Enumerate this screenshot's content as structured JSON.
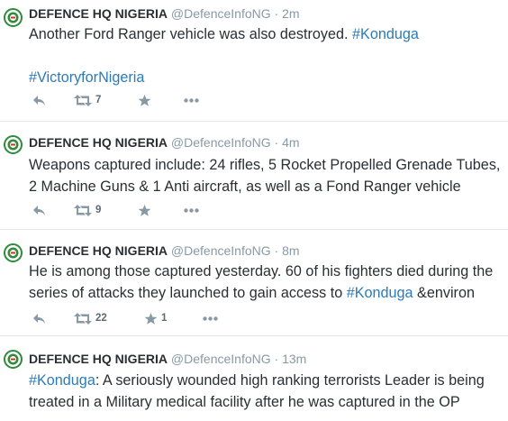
{
  "colors": {
    "link": "#2b7bb9",
    "name": "#292f33",
    "muted": "#8899a6",
    "divider": "#e1e8ed",
    "avatar_ring": "#2e8b3a"
  },
  "tweets": [
    {
      "name": "DEFENCE HQ NIGERIA",
      "handle": "@DefenceInfoNG",
      "separator": "·",
      "time": "2m",
      "text": {
        "p1": "Another Ford Ranger vehicle was also destroyed. ",
        "tag1": "#Konduga",
        "tag2": "#VictoryforNigeria"
      },
      "retweets": "7",
      "favorites": ""
    },
    {
      "name": "DEFENCE HQ NIGERIA",
      "handle": "@DefenceInfoNG",
      "separator": "·",
      "time": "4m",
      "text": {
        "line1": "Weapons captured include: 24 rifles, 5 Rocket Propelled Grenade Tubes,",
        "line2": "2 Machine Guns & 1 Anti aircraft, as well as a Fond Ranger vehicle"
      },
      "retweets": "9",
      "favorites": ""
    },
    {
      "name": "DEFENCE HQ NIGERIA",
      "handle": "@DefenceInfoNG",
      "separator": "·",
      "time": "8m",
      "text": {
        "line1": "He is among those captured yesterday. 60 of his fighters died during the",
        "line2a": "series of attacks they launched to gain access to ",
        "tag": "#Konduga",
        "line2b": " &environ"
      },
      "retweets": "22",
      "favorites": "1"
    },
    {
      "name": "DEFENCE HQ NIGERIA",
      "handle": "@DefenceInfoNG",
      "separator": "·",
      "time": "13m",
      "text": {
        "tag": "#Konduga",
        "line1": ": A seriously wounded high ranking terrorists Leader is being",
        "line2": "treated in a Military medical facility after he was captured in the OP"
      }
    }
  ]
}
